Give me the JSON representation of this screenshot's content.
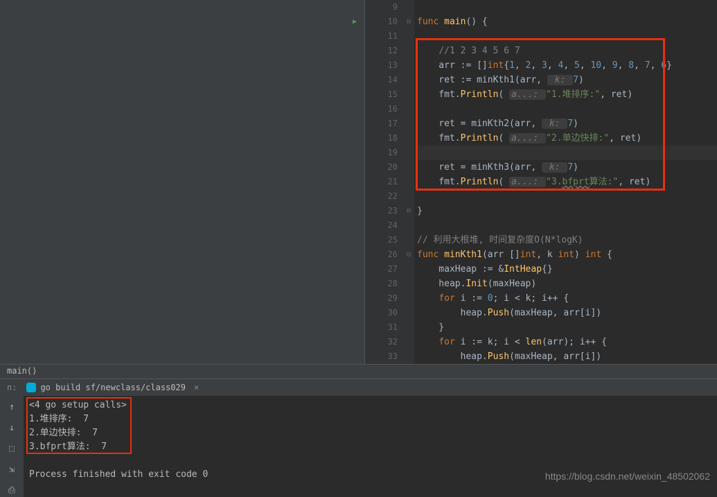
{
  "breadcrumb": "main()",
  "run_tab": {
    "label": "go build sf/newclass/class029",
    "close": "×"
  },
  "gutter": {
    "start": 9,
    "end": 33
  },
  "code_lines": [
    {
      "n": 9,
      "html": ""
    },
    {
      "n": 10,
      "run": true,
      "fold": "⊟",
      "tokens": [
        [
          "kw",
          "func "
        ],
        [
          "fn",
          "main"
        ],
        [
          "ident",
          "() {"
        ]
      ]
    },
    {
      "n": 11,
      "html": ""
    },
    {
      "n": 12,
      "tokens": [
        [
          "ident",
          "    "
        ],
        [
          "com",
          "//1 2 3 4 5 6 7"
        ]
      ]
    },
    {
      "n": 13,
      "tokens": [
        [
          "ident",
          "    arr := []"
        ],
        [
          "typ",
          "int"
        ],
        [
          "ident",
          "{"
        ],
        [
          "num",
          "1"
        ],
        [
          "ident",
          ", "
        ],
        [
          "num",
          "2"
        ],
        [
          "ident",
          ", "
        ],
        [
          "num",
          "3"
        ],
        [
          "ident",
          ", "
        ],
        [
          "num",
          "4"
        ],
        [
          "ident",
          ", "
        ],
        [
          "num",
          "5"
        ],
        [
          "ident",
          ", "
        ],
        [
          "num",
          "10"
        ],
        [
          "ident",
          ", "
        ],
        [
          "num",
          "9"
        ],
        [
          "ident",
          ", "
        ],
        [
          "num",
          "8"
        ],
        [
          "ident",
          ", "
        ],
        [
          "num",
          "7"
        ],
        [
          "ident",
          ", "
        ],
        [
          "num",
          "6"
        ],
        [
          "ident",
          "}"
        ]
      ]
    },
    {
      "n": 14,
      "tokens": [
        [
          "ident",
          "    ret := minKth1(arr, "
        ],
        [
          "hint",
          " k: "
        ],
        [
          "num",
          "7"
        ],
        [
          "ident",
          ")"
        ]
      ]
    },
    {
      "n": 15,
      "tokens": [
        [
          "ident",
          "    fmt."
        ],
        [
          "fn",
          "Println"
        ],
        [
          "ident",
          "( "
        ],
        [
          "hint",
          "a...: "
        ],
        [
          "str",
          "\"1.堆排序:\""
        ],
        [
          "ident",
          ", ret)"
        ]
      ]
    },
    {
      "n": 16,
      "html": ""
    },
    {
      "n": 17,
      "tokens": [
        [
          "ident",
          "    ret = minKth2(arr, "
        ],
        [
          "hint",
          " k: "
        ],
        [
          "num",
          "7"
        ],
        [
          "ident",
          ")"
        ]
      ]
    },
    {
      "n": 18,
      "tokens": [
        [
          "ident",
          "    fmt."
        ],
        [
          "fn",
          "Println"
        ],
        [
          "ident",
          "( "
        ],
        [
          "hint",
          "a...: "
        ],
        [
          "str",
          "\"2.单边快排:\""
        ],
        [
          "ident",
          ", ret)"
        ]
      ]
    },
    {
      "n": 19,
      "caret": true,
      "html": ""
    },
    {
      "n": 20,
      "tokens": [
        [
          "ident",
          "    ret = minKth3(arr, "
        ],
        [
          "hint",
          " k: "
        ],
        [
          "num",
          "7"
        ],
        [
          "ident",
          ")"
        ]
      ]
    },
    {
      "n": 21,
      "tokens": [
        [
          "ident",
          "    fmt."
        ],
        [
          "fn",
          "Println"
        ],
        [
          "ident",
          "( "
        ],
        [
          "hint",
          "a...: "
        ],
        [
          "str",
          "\"3."
        ],
        [
          "wavy",
          "bfprt"
        ],
        [
          "str",
          "算法:\""
        ],
        [
          "ident",
          ", ret)"
        ]
      ]
    },
    {
      "n": 22,
      "html": ""
    },
    {
      "n": 23,
      "fold": "⊟",
      "tokens": [
        [
          "ident",
          "}"
        ]
      ]
    },
    {
      "n": 24,
      "html": ""
    },
    {
      "n": 25,
      "tokens": [
        [
          "com",
          "// 利用大根堆, 时间复杂度O(N*logK)"
        ]
      ]
    },
    {
      "n": 26,
      "fold": "⊟",
      "tokens": [
        [
          "kw",
          "func "
        ],
        [
          "fn",
          "minKth1"
        ],
        [
          "ident",
          "(arr []"
        ],
        [
          "typ",
          "int"
        ],
        [
          "ident",
          ", k "
        ],
        [
          "typ",
          "int"
        ],
        [
          "ident",
          ") "
        ],
        [
          "typ",
          "int"
        ],
        [
          "ident",
          " {"
        ]
      ]
    },
    {
      "n": 27,
      "tokens": [
        [
          "ident",
          "    maxHeap := &"
        ],
        [
          "fn",
          "IntHeap"
        ],
        [
          "ident",
          "{}"
        ]
      ]
    },
    {
      "n": 28,
      "tokens": [
        [
          "ident",
          "    heap."
        ],
        [
          "fn",
          "Init"
        ],
        [
          "ident",
          "(maxHeap)"
        ]
      ]
    },
    {
      "n": 29,
      "tokens": [
        [
          "ident",
          "    "
        ],
        [
          "kw",
          "for"
        ],
        [
          "ident",
          " i := "
        ],
        [
          "num",
          "0"
        ],
        [
          "ident",
          "; i < k; i++ {"
        ]
      ]
    },
    {
      "n": 30,
      "tokens": [
        [
          "ident",
          "        heap."
        ],
        [
          "fn",
          "Push"
        ],
        [
          "ident",
          "(maxHeap, arr[i])"
        ]
      ]
    },
    {
      "n": 31,
      "tokens": [
        [
          "ident",
          "    }"
        ]
      ]
    },
    {
      "n": 32,
      "tokens": [
        [
          "ident",
          "    "
        ],
        [
          "kw",
          "for"
        ],
        [
          "ident",
          " i := k; i < "
        ],
        [
          "fn",
          "len"
        ],
        [
          "ident",
          "(arr); i++ {"
        ]
      ]
    },
    {
      "n": 33,
      "tokens": [
        [
          "ident",
          "        heap."
        ],
        [
          "fn",
          "Push"
        ],
        [
          "ident",
          "(maxHeap, arr[i])"
        ]
      ]
    }
  ],
  "console": [
    "<4 go setup calls>",
    "1.堆排序:  7",
    "2.单边快排:  7",
    "3.bfprt算法:  7",
    "",
    "Process finished with exit code 0"
  ],
  "watermark": "https://blog.csdn.net/weixin_48502062"
}
